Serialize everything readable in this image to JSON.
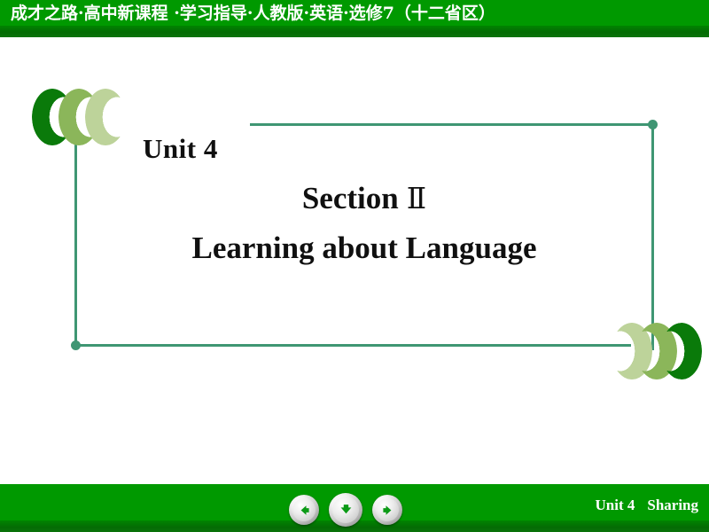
{
  "header": {
    "title": "成才之路·高中新课程 ·学习指导·人教版·英语·选修7（十二省区）",
    "bg_color": "#009900"
  },
  "slide": {
    "unit_label": "Unit 4",
    "section_title": "Section",
    "section_numeral": "Ⅱ",
    "section_subtitle": "Learning about Language",
    "accent_color": "#3f9673",
    "text_color": "#101010",
    "decorations": {
      "chevrons_top_left": [
        {
          "name": "chevron-dark-green",
          "color": "#0a7a0a",
          "direction": "left"
        },
        {
          "name": "chevron-mid-green",
          "color": "#8bb65a",
          "direction": "left"
        },
        {
          "name": "chevron-light-green",
          "color": "#bdd39a",
          "direction": "left"
        }
      ],
      "chevrons_bottom_right": [
        {
          "name": "chevron-light-green",
          "color": "#bdd39a",
          "direction": "right"
        },
        {
          "name": "chevron-mid-green",
          "color": "#8bb65a",
          "direction": "right"
        },
        {
          "name": "chevron-dark-green",
          "color": "#0a7a0a",
          "direction": "right"
        }
      ]
    }
  },
  "footer": {
    "unit_label": "Unit 4",
    "section_label": "Sharing",
    "bg_color": "#009900",
    "buttons": [
      {
        "name": "previous-slide-button",
        "icon": "arrow-left-icon"
      },
      {
        "name": "down-slide-button",
        "icon": "arrow-down-icon"
      },
      {
        "name": "next-slide-button",
        "icon": "arrow-right-icon"
      }
    ]
  }
}
